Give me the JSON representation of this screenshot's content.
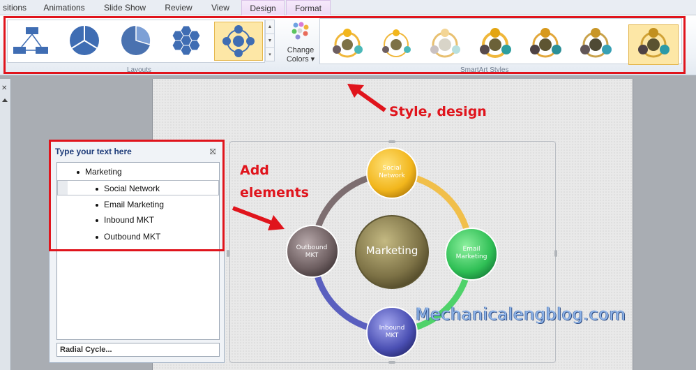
{
  "tabs": [
    "sitions",
    "Animations",
    "Slide Show",
    "Review",
    "View",
    "Design",
    "Format"
  ],
  "ribbon": {
    "layouts_label": "Layouts",
    "change_colors_line1": "Change",
    "change_colors_line2": "Colors",
    "smartart_styles_label": "SmartArt Styles"
  },
  "text_pane": {
    "title": "Type your text here",
    "items": [
      {
        "text": "Marketing",
        "level": 1
      },
      {
        "text": "Social Network",
        "level": 2
      },
      {
        "text": "Email Marketing",
        "level": 2
      },
      {
        "text": "Inbound MKT",
        "level": 2
      },
      {
        "text": "Outbound MKT",
        "level": 2
      }
    ],
    "footer": "Radial Cycle..."
  },
  "diagram": {
    "center": "Marketing",
    "nodes": [
      {
        "line1": "Social",
        "line2": "Network"
      },
      {
        "line1": "Email",
        "line2": "Marketing"
      },
      {
        "line1": "Inbound",
        "line2": "MKT"
      },
      {
        "line1": "Outbound",
        "line2": "MKT"
      }
    ]
  },
  "annotations": {
    "style_design": "Style, design",
    "add_line1": "Add",
    "add_line2": "elements",
    "watermark": "Mechanicalengblog.com"
  },
  "colors": {
    "annotation_red": "#e0141c",
    "node_social": "#f2b61c",
    "node_email": "#2fbf55",
    "node_inbound": "#4a4fb3",
    "node_outbound": "#6d5e60",
    "node_center": "#7d7246"
  }
}
